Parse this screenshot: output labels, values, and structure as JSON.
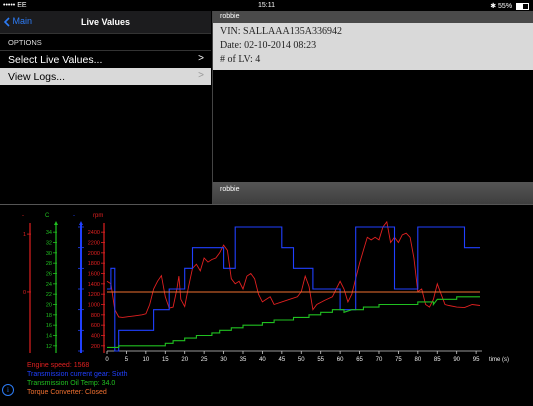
{
  "status_bar": {
    "carrier": "••••• EE",
    "time": "15:11",
    "battery": "55%",
    "battery_level": 0.55
  },
  "left_pane": {
    "back_label": "Main",
    "title": "Live Values",
    "section_header": "OPTIONS",
    "items": [
      {
        "label": "Select Live Values...",
        "chevron": ">"
      },
      {
        "label": "View Logs...",
        "chevron": ">"
      }
    ]
  },
  "right_pane": {
    "header": "robbie",
    "vin": "VIN: SALLAAA135A336942",
    "date": "Date: 02-10-2014 08:23",
    "lv_count": "# of LV: 4"
  },
  "colors": {
    "rpm": "#e02020",
    "gear": "#2040ff",
    "temp": "#20c020",
    "converter": "#f07030",
    "accent": "#2d7cf6"
  },
  "chart_data": {
    "type": "line",
    "x_label": "time (s)",
    "x_ticks": [
      0,
      5,
      10,
      15,
      20,
      25,
      30,
      35,
      40,
      45,
      50,
      55,
      60,
      65,
      70,
      75,
      80,
      85,
      90,
      95
    ],
    "xlim": [
      0,
      96
    ],
    "axes": [
      {
        "unit": "-",
        "color": "#e02020",
        "ticks": [
          "1",
          "0"
        ],
        "ylim": [
          -1,
          1.1
        ]
      },
      {
        "unit": "C",
        "color": "#20c020",
        "ticks": [
          12,
          14,
          16,
          18,
          20,
          22,
          24,
          26,
          28,
          30,
          32,
          34
        ],
        "ylim": [
          11,
          35
        ]
      },
      {
        "unit": "-",
        "color": "#2040ff",
        "ticks": [],
        "ylim": [
          0,
          6
        ]
      },
      {
        "unit": "rpm",
        "color": "#e02020",
        "ticks": [
          200,
          400,
          600,
          800,
          1000,
          1200,
          1400,
          1600,
          1800,
          2000,
          2200,
          2400
        ],
        "ylim": [
          100,
          2500
        ]
      }
    ],
    "series": [
      {
        "name": "Engine speed",
        "axis": 3,
        "color": "#e02020",
        "points": [
          [
            0,
            1450
          ],
          [
            1,
            1400
          ],
          [
            2,
            900
          ],
          [
            3,
            760
          ],
          [
            4,
            750
          ],
          [
            5,
            760
          ],
          [
            7,
            780
          ],
          [
            9,
            800
          ],
          [
            10,
            820
          ],
          [
            11,
            1000
          ],
          [
            12,
            1300
          ],
          [
            13,
            1450
          ],
          [
            14,
            1560
          ],
          [
            15,
            1150
          ],
          [
            16,
            930
          ],
          [
            17,
            950
          ],
          [
            18,
            1300
          ],
          [
            18.5,
            1550
          ],
          [
            19,
            1100
          ],
          [
            20,
            960
          ],
          [
            21,
            1350
          ],
          [
            22,
            1700
          ],
          [
            23,
            1780
          ],
          [
            24,
            1650
          ],
          [
            25,
            1900
          ],
          [
            26,
            1820
          ],
          [
            27,
            1870
          ],
          [
            28,
            1900
          ],
          [
            29,
            2000
          ],
          [
            30,
            2150
          ],
          [
            31,
            2050
          ],
          [
            32,
            1500
          ],
          [
            33,
            1400
          ],
          [
            34,
            1450
          ],
          [
            35,
            1300
          ],
          [
            36,
            1550
          ],
          [
            37,
            1600
          ],
          [
            38,
            1500
          ],
          [
            39,
            1200
          ],
          [
            40,
            1050
          ],
          [
            41,
            1100
          ],
          [
            42,
            1150
          ],
          [
            43,
            1000
          ],
          [
            45,
            1050
          ],
          [
            47,
            1100
          ],
          [
            49,
            1150
          ],
          [
            50,
            1250
          ],
          [
            51,
            1550
          ],
          [
            52,
            1350
          ],
          [
            53,
            900
          ],
          [
            54,
            1000
          ],
          [
            56,
            1080
          ],
          [
            58,
            1150
          ],
          [
            59,
            1300
          ],
          [
            60,
            1450
          ],
          [
            61,
            1300
          ],
          [
            62,
            1050
          ],
          [
            63,
            1200
          ],
          [
            64,
            1500
          ],
          [
            65,
            1800
          ],
          [
            66,
            2050
          ],
          [
            67,
            2300
          ],
          [
            68,
            2250
          ],
          [
            69,
            2300
          ],
          [
            70,
            2250
          ],
          [
            71,
            2500
          ],
          [
            72,
            2600
          ],
          [
            73,
            2200
          ],
          [
            74,
            2300
          ],
          [
            75,
            2200
          ],
          [
            76,
            2350
          ],
          [
            77,
            2380
          ],
          [
            78,
            2300
          ],
          [
            79,
            1900
          ],
          [
            80,
            1250
          ],
          [
            81,
            1300
          ],
          [
            82,
            1000
          ],
          [
            83,
            950
          ],
          [
            84,
            1100
          ],
          [
            85,
            1400
          ],
          [
            86,
            1200
          ],
          [
            87,
            1000
          ],
          [
            88,
            980
          ],
          [
            90,
            950
          ],
          [
            92,
            940
          ],
          [
            94,
            1000
          ],
          [
            96,
            980
          ]
        ]
      },
      {
        "name": "Transmission current gear",
        "axis": 2,
        "value_label": "Sixth",
        "color": "#2040ff",
        "points": [
          [
            0,
            3
          ],
          [
            1,
            3
          ],
          [
            1,
            4
          ],
          [
            2,
            4
          ],
          [
            2,
            0
          ],
          [
            3,
            0
          ],
          [
            3,
            1
          ],
          [
            12,
            1
          ],
          [
            12,
            2
          ],
          [
            16,
            2
          ],
          [
            16,
            3
          ],
          [
            20,
            3
          ],
          [
            20,
            4
          ],
          [
            22,
            4
          ],
          [
            22,
            5
          ],
          [
            30,
            5
          ],
          [
            30,
            4
          ],
          [
            33,
            4
          ],
          [
            33,
            6
          ],
          [
            45,
            6
          ],
          [
            45,
            5
          ],
          [
            48,
            5
          ],
          [
            48,
            4
          ],
          [
            53,
            4
          ],
          [
            53,
            3
          ],
          [
            60,
            3
          ],
          [
            60,
            2
          ],
          [
            64,
            2
          ],
          [
            64,
            6
          ],
          [
            74,
            6
          ],
          [
            74,
            3
          ],
          [
            80,
            3
          ],
          [
            80,
            6
          ],
          [
            92,
            6
          ],
          [
            92,
            5
          ],
          [
            96,
            5
          ]
        ]
      },
      {
        "name": "Transmission Oil Temp",
        "axis": 1,
        "value_label": "34.0",
        "color": "#20c020",
        "points": [
          [
            0,
            11.7
          ],
          [
            3,
            11.7
          ],
          [
            3,
            12
          ],
          [
            15,
            12
          ],
          [
            15,
            12.5
          ],
          [
            17,
            12.5
          ],
          [
            17,
            13
          ],
          [
            20,
            13
          ],
          [
            20,
            13.5
          ],
          [
            23,
            13.5
          ],
          [
            23,
            14
          ],
          [
            27,
            14
          ],
          [
            27,
            14.5
          ],
          [
            29,
            14.5
          ],
          [
            29,
            15
          ],
          [
            32,
            15
          ],
          [
            32,
            15.5
          ],
          [
            35,
            15.5
          ],
          [
            35,
            16
          ],
          [
            40,
            16
          ],
          [
            40,
            16.5
          ],
          [
            43,
            16.5
          ],
          [
            43,
            17
          ],
          [
            48,
            17
          ],
          [
            48,
            17.5
          ],
          [
            52,
            17.5
          ],
          [
            52,
            18
          ],
          [
            55,
            18
          ],
          [
            55,
            18.5
          ],
          [
            58,
            18.5
          ],
          [
            58,
            19
          ],
          [
            61,
            19
          ],
          [
            61,
            18.5
          ],
          [
            63,
            19
          ],
          [
            66,
            19
          ],
          [
            66,
            19.5
          ],
          [
            70,
            19.5
          ],
          [
            70,
            20
          ],
          [
            80,
            20
          ],
          [
            80,
            20.5
          ],
          [
            84,
            20.5
          ],
          [
            84,
            20
          ],
          [
            85,
            21
          ],
          [
            90,
            21
          ],
          [
            90,
            21.5
          ],
          [
            96,
            21.5
          ]
        ]
      },
      {
        "name": "Torque Converter",
        "axis": 0,
        "value_label": "Closed",
        "color": "#f07030",
        "points": [
          [
            0,
            0
          ],
          [
            96,
            0
          ]
        ]
      }
    ],
    "legend": [
      {
        "text": "Engine speed: 1568",
        "color": "#e02020"
      },
      {
        "text": "Transmission current gear: Sixth",
        "color": "#2040ff"
      },
      {
        "text": "Transmission Oil Temp: 34.0",
        "color": "#20c020"
      },
      {
        "text": "Torque Converter: Closed",
        "color": "#f07030"
      }
    ]
  }
}
